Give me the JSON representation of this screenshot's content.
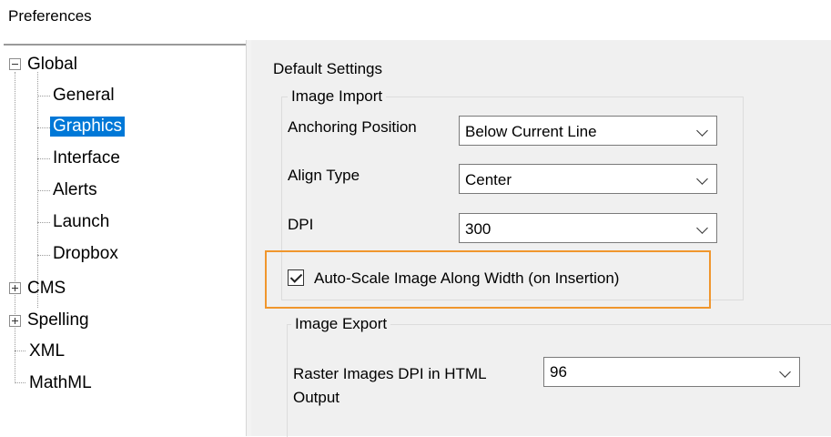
{
  "window": {
    "title": "Preferences"
  },
  "tree": {
    "global": "Global",
    "general": "General",
    "graphics": "Graphics",
    "interface": "Interface",
    "alerts": "Alerts",
    "launch": "Launch",
    "dropbox": "Dropbox",
    "cms": "CMS",
    "spelling": "Spelling",
    "xml": "XML",
    "mathml": "MathML",
    "selected": "Graphics"
  },
  "content": {
    "section_title": "Default Settings",
    "image_import": {
      "legend": "Image Import",
      "anchoring_label": "Anchoring Position",
      "anchoring_value": "Below Current Line",
      "align_label": "Align Type",
      "align_value": "Center",
      "dpi_label": "DPI",
      "dpi_value": "300",
      "autoscale_label": "Auto-Scale Image Along Width (on Insertion)",
      "autoscale_checked": true
    },
    "image_export": {
      "legend": "Image Export",
      "raster_label_line1": "Raster Images DPI in HTML",
      "raster_label_line2": "Output",
      "raster_value": "96"
    }
  },
  "colors": {
    "selection": "#0078d7",
    "highlight_border": "#f0962d",
    "panel_bg": "#f0f0f0"
  }
}
